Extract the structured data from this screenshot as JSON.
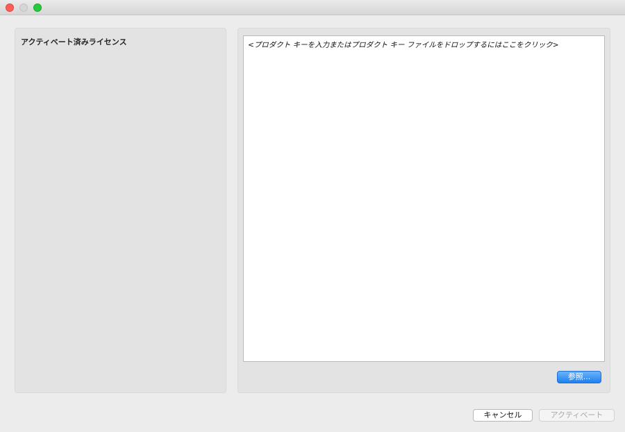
{
  "window": {
    "controls": [
      "close-icon",
      "minimize-icon",
      "zoom-icon"
    ]
  },
  "left_panel": {
    "heading": "アクティベート済みライセンス"
  },
  "right_panel": {
    "key_placeholder": "<プロダクト キーを入力またはプロダクト キー ファイルをドロップするにはここをクリック>",
    "browse_label": "参照..."
  },
  "footer": {
    "cancel_label": "キャンセル",
    "activate_label": "アクティベート",
    "activate_enabled": false
  },
  "colors": {
    "window_background": "#ececec",
    "panel_background": "#e3e3e3",
    "accent_blue": "#1f7ff0",
    "close_red": "#ff5f57",
    "zoom_green": "#28c940",
    "disabled_text": "#a8a8a8"
  }
}
